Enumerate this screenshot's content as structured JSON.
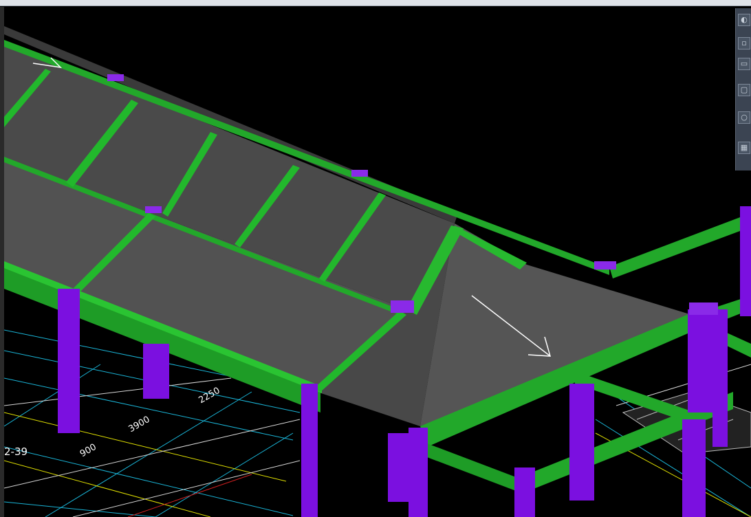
{
  "window": {
    "title": "",
    "background_color": "#000000"
  },
  "viewport": {
    "dimension_labels": [
      "2250",
      "3900",
      "900",
      "2-39"
    ],
    "colors": {
      "beam": "#22a82a",
      "column": "#7b10e0",
      "roof_panel": "#4e4e4e",
      "grid_line": "#1fd6ff",
      "axis_line": "#e0e000"
    }
  },
  "toolbar": {
    "buttons": [
      {
        "icon": "orbit-icon",
        "label": ""
      },
      {
        "icon": "view-front-icon",
        "label": ""
      },
      {
        "icon": "view-box-icon",
        "label": ""
      },
      {
        "icon": "view-camera-icon",
        "label": ""
      },
      {
        "icon": "circle-icon",
        "label": ""
      },
      {
        "icon": "grid-panel-icon",
        "label": ""
      }
    ]
  }
}
